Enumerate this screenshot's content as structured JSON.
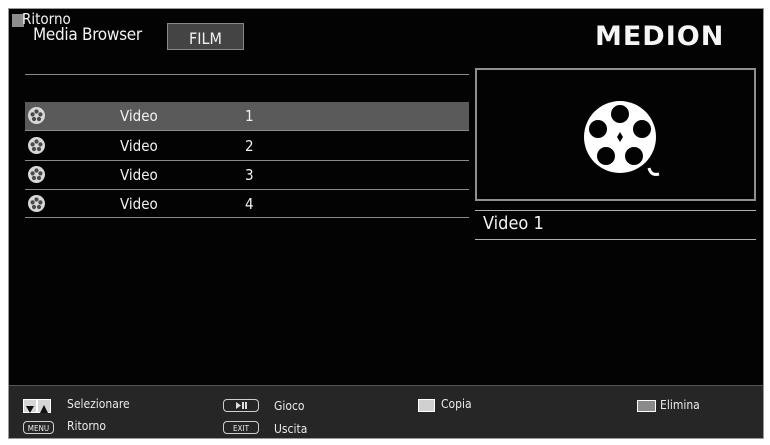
{
  "header": {
    "title": "Media Browser",
    "tab_label": "FILM",
    "logo_text": "MEDION"
  },
  "list": {
    "back_label": "Ritorno",
    "items": [
      {
        "name": "Video",
        "number": "1",
        "selected": true
      },
      {
        "name": "Video",
        "number": "2",
        "selected": false
      },
      {
        "name": "Video",
        "number": "3",
        "selected": false
      },
      {
        "name": "Video",
        "number": "4",
        "selected": false
      }
    ],
    "item_icon": "film-reel-icon"
  },
  "preview": {
    "icon": "film-reel-icon",
    "title": "Video 1"
  },
  "footer": {
    "select_label": "Selezionare",
    "menu_key": "MENU",
    "back_label": "Ritorno",
    "play_label": "Gioco",
    "exit_key": "EXIT",
    "exit_label": "Uscita",
    "copy_label": "Copia",
    "delete_label": "Elimina"
  },
  "colors": {
    "background": "#030303",
    "selected_row": "#5a5a5a",
    "tab_background": "#444444",
    "footer_background": "#262626"
  }
}
